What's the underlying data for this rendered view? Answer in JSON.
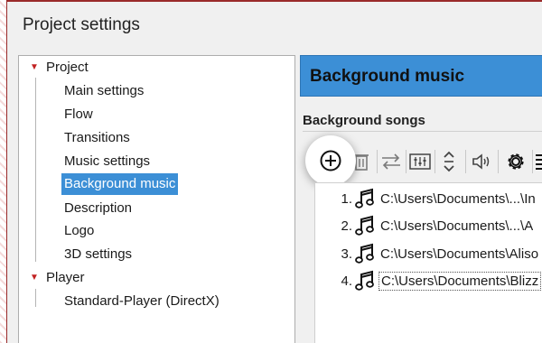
{
  "window": {
    "title": "Project settings"
  },
  "tree": {
    "items": [
      {
        "label": "Project"
      },
      {
        "label": "Main settings"
      },
      {
        "label": "Flow"
      },
      {
        "label": "Transitions"
      },
      {
        "label": "Music settings"
      },
      {
        "label": "Background music",
        "selected": true
      },
      {
        "label": "Description"
      },
      {
        "label": "Logo"
      },
      {
        "label": "3D settings"
      },
      {
        "label": "Player"
      },
      {
        "label": "Standard-Player (DirectX)"
      }
    ]
  },
  "panel": {
    "header": "Background music",
    "section_label": "Background songs"
  },
  "toolbar": {
    "buttons": [
      "add-icon",
      "delete-icon",
      "swap-icon",
      "mixer-icon",
      "move-icon",
      "volume-icon",
      "gear-icon"
    ]
  },
  "songs": [
    {
      "num": "1.",
      "path": "C:\\Users\\Documents\\...\\In"
    },
    {
      "num": "2.",
      "path": "C:\\Users\\Documents\\...\\A"
    },
    {
      "num": "3.",
      "path": "C:\\Users\\Documents\\Aliso"
    },
    {
      "num": "4.",
      "path": "C:\\Users\\Documents\\Blizz"
    }
  ],
  "colors": {
    "selection": "#3c8fd6",
    "expander": "#c22222",
    "window_border": "#9a2a2a"
  }
}
